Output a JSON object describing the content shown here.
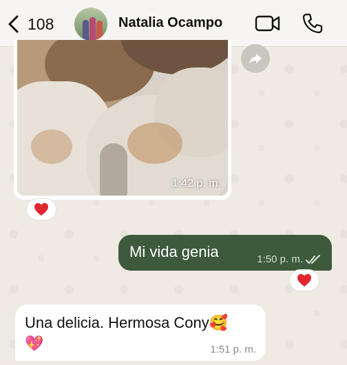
{
  "header": {
    "back_count": "108",
    "contact_name": "Natalia Ocampo",
    "icons": {
      "back": "chevron-left-icon",
      "video": "video-camera-icon",
      "call": "phone-icon"
    }
  },
  "messages": [
    {
      "type": "image",
      "direction": "incoming",
      "time": "1:42 p. m.",
      "reaction": "red-heart"
    },
    {
      "type": "text",
      "direction": "outgoing",
      "text": "Mi vida genia",
      "time": "1:50 p. m.",
      "status": "read-double-check",
      "reaction": "red-heart"
    },
    {
      "type": "text",
      "direction": "incoming",
      "text": "Una delicia. Hermosa Cony🥰",
      "text_line2": "💖",
      "time": "1:51 p. m."
    }
  ],
  "colors": {
    "outgoing_bubble": "#3d5a3d",
    "incoming_bubble": "#ffffff",
    "heart": "#e0262e"
  }
}
